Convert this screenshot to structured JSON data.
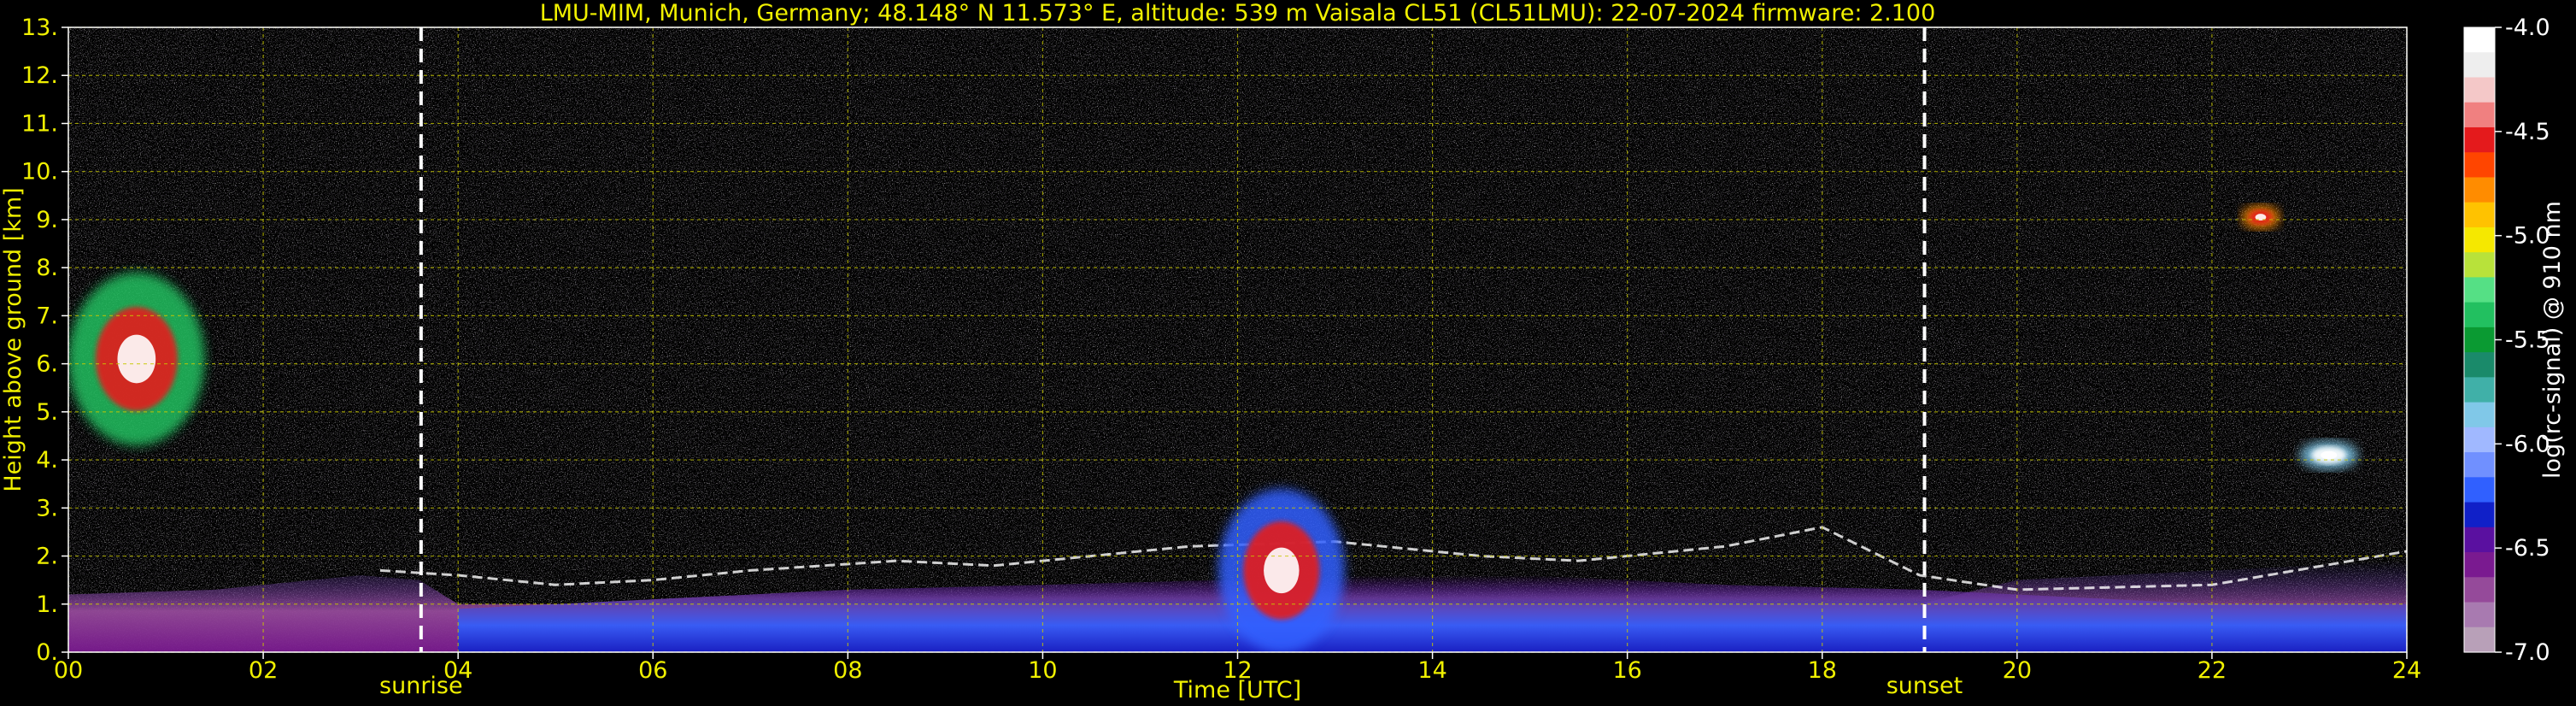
{
  "chart_data": {
    "type": "heatmap",
    "title": "LMU-MIM, Munich, Germany; 48.148° N 11.573° E, altitude: 539 m    Vaisala CL51 (CL51LMU): 22-07-2024    firmware: 2.100",
    "xlabel": "Time [UTC]",
    "ylabel": "Height above ground [km]",
    "xlim": [
      0,
      24
    ],
    "ylim": [
      0,
      13
    ],
    "x_ticks": [
      "00",
      "02",
      "04",
      "06",
      "08",
      "10",
      "12",
      "14",
      "16",
      "18",
      "20",
      "22",
      "24"
    ],
    "y_ticks": [
      "0.",
      "1.",
      "2.",
      "3.",
      "4.",
      "5.",
      "6.",
      "7.",
      "8.",
      "9.",
      "10.",
      "11.",
      "12.",
      "13."
    ],
    "grid": true,
    "events": [
      {
        "label": "sunrise",
        "time": 3.62
      },
      {
        "label": "sunset",
        "time": 19.05
      }
    ],
    "colorbar": {
      "label": "log(rc-signal) @ 910 nm",
      "range": [
        -7.0,
        -4.0
      ],
      "ticks": [
        "-4.0",
        "-4.5",
        "-5.0",
        "-5.5",
        "-6.0",
        "-6.5",
        "-7.0"
      ],
      "colors": [
        "#ffffff",
        "#eeeeee",
        "#f4c8c8",
        "#f08080",
        "#e41a1c",
        "#ff4500",
        "#ff8c00",
        "#ffc200",
        "#f5e800",
        "#b8e23a",
        "#55e085",
        "#22c060",
        "#0a9a32",
        "#1a8a6a",
        "#40b0a8",
        "#80c8e8",
        "#a0b8ff",
        "#7090ff",
        "#3060ff",
        "#1020c8",
        "#5a10a0",
        "#7a1a90",
        "#954a9a",
        "#a87ab0",
        "#b8a0b8"
      ]
    },
    "features": [
      {
        "name": "cirrus-early",
        "time_range": [
          0,
          1.4
        ],
        "height_range_km": [
          4.3,
          7.9
        ]
      },
      {
        "name": "cloud-near-12utc",
        "time_range": [
          11.8,
          13.1
        ],
        "height_range_km": [
          0,
          3.4
        ]
      },
      {
        "name": "cloud-near-22utc",
        "time_range": [
          22.3,
          22.7
        ],
        "height_range_km": [
          8.8,
          9.3
        ]
      },
      {
        "name": "cloud-near-23utc",
        "time_range": [
          22.9,
          23.5
        ],
        "height_range_km": [
          3.8,
          4.4
        ]
      },
      {
        "name": "boundary-layer-top",
        "time_range": [
          0,
          24
        ],
        "height_range_km": [
          0,
          2.6
        ]
      }
    ],
    "backscatter_levels": [
      {
        "name": "free-troposphere-noise",
        "height_range_km": [
          2.5,
          13
        ],
        "log_signal": [
          -7.0,
          -6.5
        ]
      },
      {
        "name": "mixed-layer-day",
        "time_range": [
          4,
          19
        ],
        "height_range_km": [
          0,
          1.8
        ],
        "log_signal": [
          -6.5,
          -6.0
        ]
      },
      {
        "name": "residual-layer-night",
        "time_range": [
          0,
          3.6
        ],
        "height_range_km": [
          0,
          1.6
        ],
        "log_signal": [
          -6.8,
          -6.4
        ]
      },
      {
        "name": "cirrus-early",
        "time_range": [
          0,
          1.4
        ],
        "height_range_km": [
          4.3,
          7.9
        ],
        "log_signal": [
          -6.0,
          -4.6
        ]
      },
      {
        "name": "cloud-near-12utc",
        "time_range": [
          11.8,
          13.1
        ],
        "height_range_km": [
          0,
          3.4
        ],
        "log_signal": [
          -5.5,
          -4.0
        ]
      }
    ]
  }
}
